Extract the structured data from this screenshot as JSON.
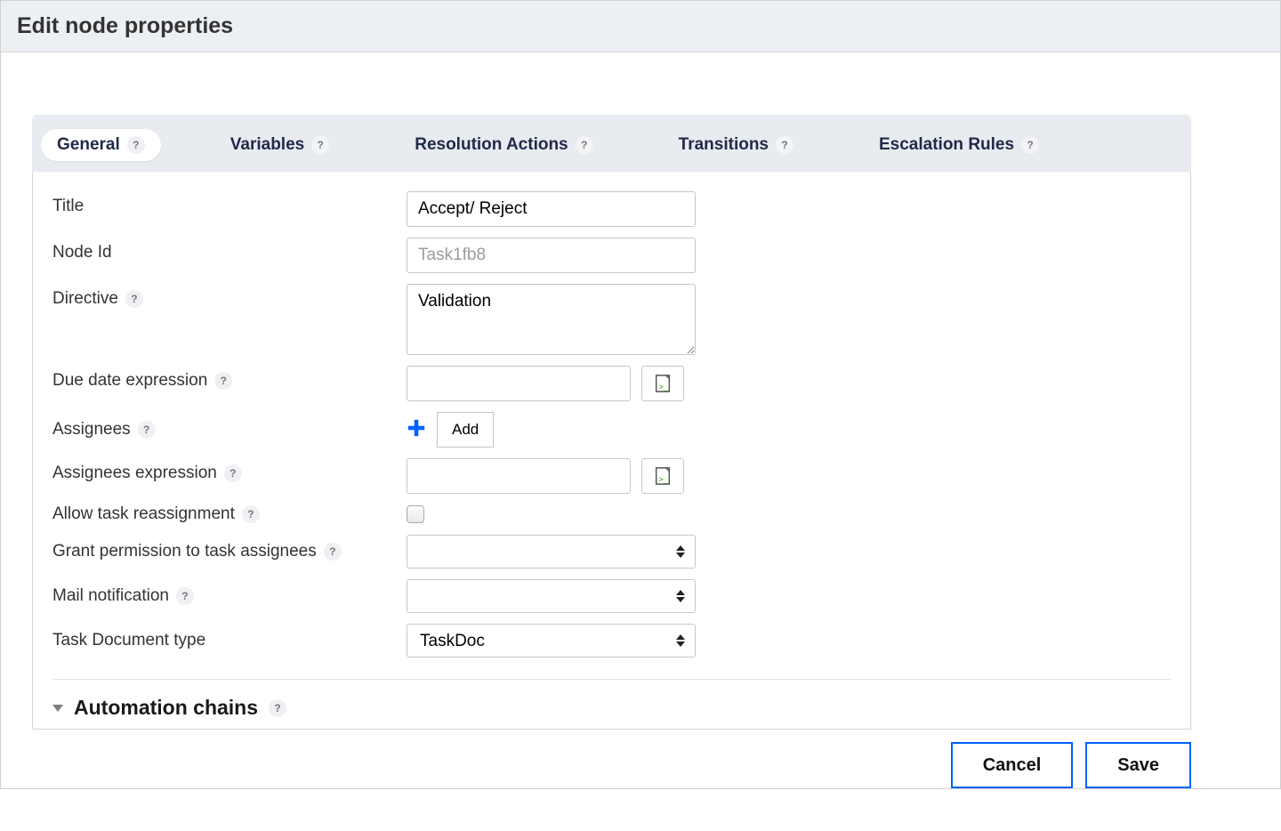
{
  "header": {
    "title": "Edit node properties"
  },
  "tabs": [
    {
      "label": "General"
    },
    {
      "label": "Variables"
    },
    {
      "label": "Resolution Actions"
    },
    {
      "label": "Transitions"
    },
    {
      "label": "Escalation Rules"
    }
  ],
  "form": {
    "title_label": "Title",
    "title_value": "Accept/ Reject",
    "node_id_label": "Node Id",
    "node_id_value": "Task1fb8",
    "directive_label": "Directive",
    "directive_value": "Validation",
    "due_date_label": "Due date expression",
    "due_date_value": "",
    "assignees_label": "Assignees",
    "add_label": "Add",
    "assignees_expr_label": "Assignees expression",
    "assignees_expr_value": "",
    "allow_reassign_label": "Allow task reassignment",
    "allow_reassign_checked": false,
    "grant_perm_label": "Grant permission to task assignees",
    "grant_perm_value": "",
    "mail_notif_label": "Mail notification",
    "mail_notif_value": "",
    "task_doc_type_label": "Task Document type",
    "task_doc_type_value": "TaskDoc"
  },
  "section": {
    "automation_chains_label": "Automation chains"
  },
  "footer": {
    "cancel": "Cancel",
    "save": "Save"
  },
  "help_char": "?"
}
